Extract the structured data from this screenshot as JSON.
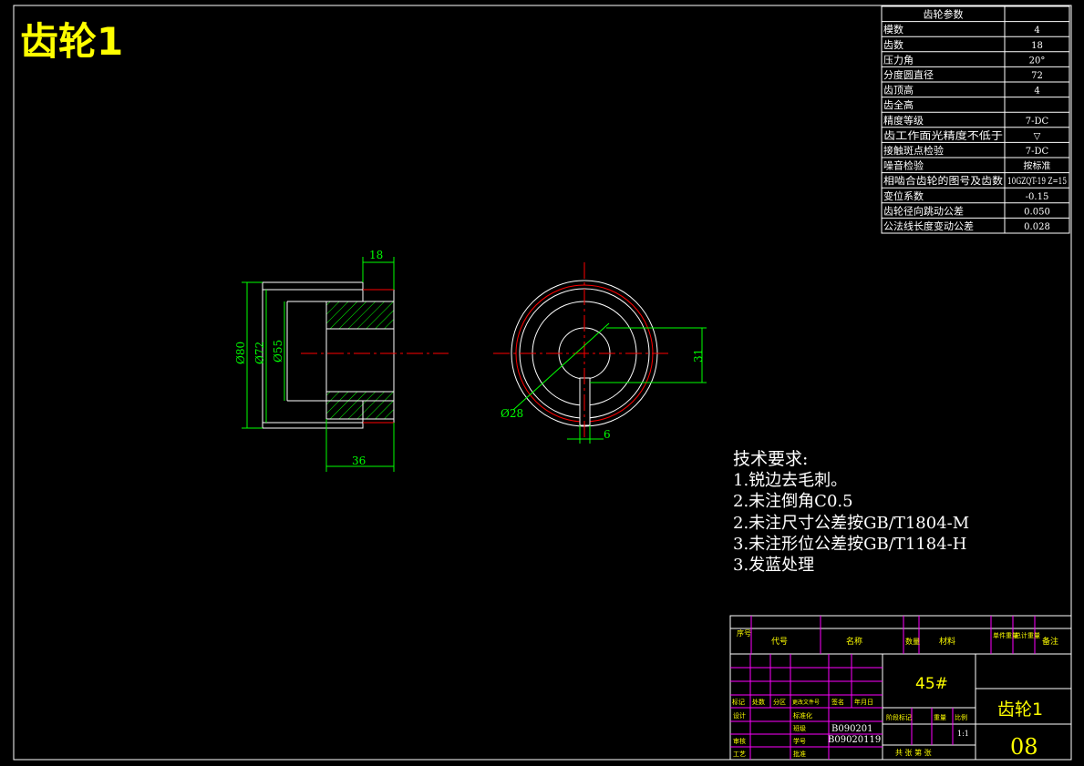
{
  "drawing": {
    "title": "齿轮1",
    "colors": {
      "background": "#000000",
      "line": "#ffffff",
      "dimension": "#00ff00",
      "centerline": "#ff0000",
      "title": "#ffff00",
      "grid_accent": "#ff00ff"
    }
  },
  "param_table": {
    "header": "齿轮参数",
    "rows": [
      {
        "label": "模数",
        "value": "4"
      },
      {
        "label": "齿数",
        "value": "18"
      },
      {
        "label": "压力角",
        "value": "20°"
      },
      {
        "label": "分度圆直径",
        "value": "72"
      },
      {
        "label": "齿顶高",
        "value": "4"
      },
      {
        "label": "齿全高",
        "value": ""
      },
      {
        "label": "精度等级",
        "value": "7-DC"
      },
      {
        "label": "齿工作面光精度不低于",
        "value": "▽"
      },
      {
        "label": "接触斑点检验",
        "value": "7-DC"
      },
      {
        "label": "噪音检验",
        "value": "按标准"
      },
      {
        "label": "相啮合齿轮的图号及齿数",
        "value": "10GZQT-19 Z=15"
      },
      {
        "label": "变位系数",
        "value": "-0.15"
      },
      {
        "label": "齿轮径向跳动公差",
        "value": "0.050"
      },
      {
        "label": "公法线长度变动公差",
        "value": "0.028"
      }
    ]
  },
  "section_view": {
    "dims": {
      "width_top": "18",
      "width_bottom": "36",
      "d_outer": "Ø80",
      "d_pitch": "Ø72",
      "d_inner": "Ø55"
    }
  },
  "end_view": {
    "dims": {
      "keyway_height": "31",
      "keyway_width": "6",
      "bore": "Ø28"
    }
  },
  "tech_requirements": {
    "heading": "技术要求:",
    "items": [
      "1.锐边去毛刺。",
      "2.未注倒角C0.5",
      "2.未注尺寸公差按GB/T1804-M",
      "3.未注形位公差按GB/T1184-H",
      "3.发蓝处理"
    ]
  },
  "title_block": {
    "bom_headers": [
      "序号",
      "代号",
      "名称",
      "数量",
      "材料",
      "单件重量",
      "总计重量",
      "备注"
    ],
    "material": "45#",
    "part_name": "齿轮1",
    "drawing_no": "08",
    "rev_labels": [
      "标记",
      "处数",
      "分区",
      "更改文件号",
      "签名",
      "年月日"
    ],
    "role_labels": [
      "设计",
      "标准化",
      "审核",
      "工艺",
      "批准"
    ],
    "stage_labels": [
      "阶段标记",
      "重量",
      "比例"
    ],
    "scale": "1:1",
    "codes": [
      "B090201",
      "B09020119"
    ],
    "code_labels": [
      "班级",
      "学号"
    ],
    "sheet_info": "共 张 第 张"
  }
}
